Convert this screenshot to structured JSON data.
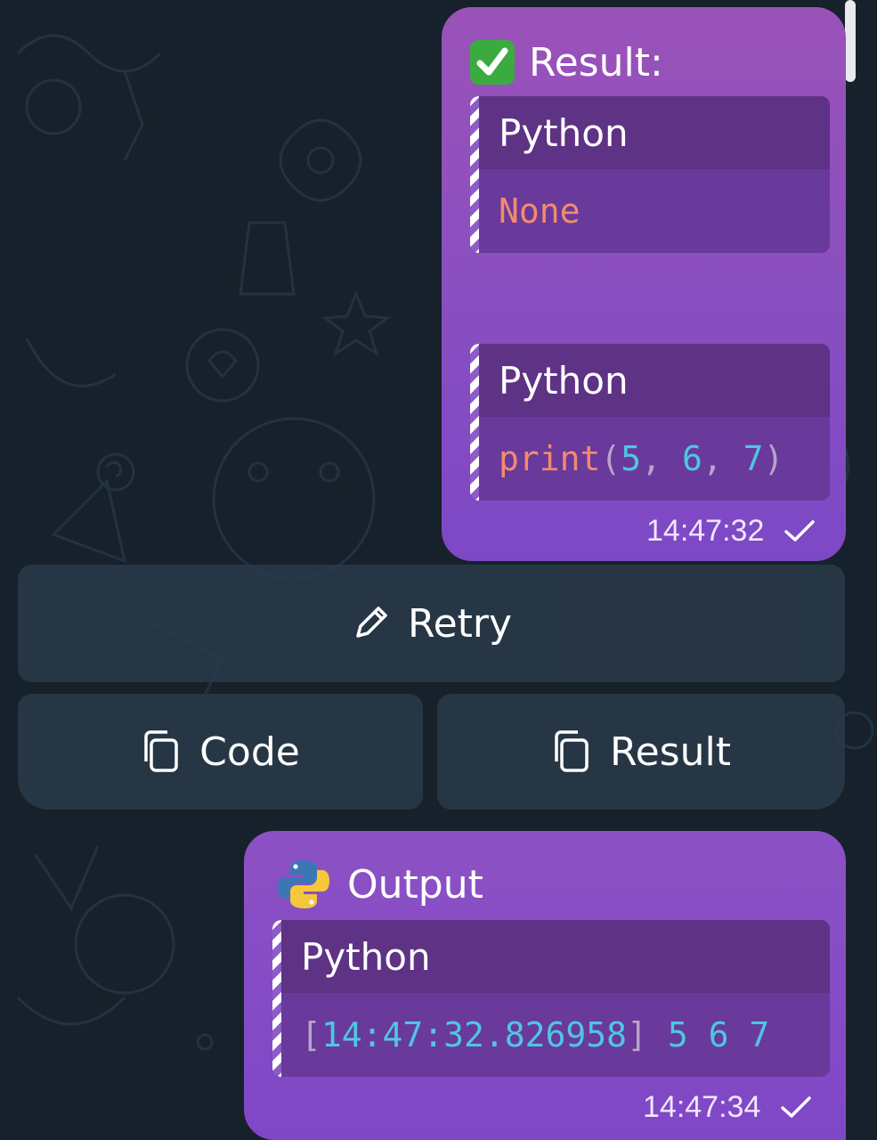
{
  "theme": {
    "background": "#17212b",
    "bubble_gradient_start": "#9a52b8",
    "bubble_gradient_end": "#7d48c6",
    "button_background": "#2a3a4a",
    "code_keyword_color": "#f28b6c",
    "code_number_color": "#4fc6e0"
  },
  "messages": [
    {
      "icon": "check-mark-emoji",
      "title": "Result:",
      "blocks": [
        {
          "language": "Python",
          "code": {
            "none": "None"
          }
        },
        {
          "language": "Python",
          "code": {
            "fn": "print",
            "open": "(",
            "a": "5",
            "sep1": ", ",
            "b": "6",
            "sep2": ", ",
            "c": "7",
            "close": ")"
          }
        }
      ],
      "time": "14:47:32",
      "status": "sent-check-icon"
    },
    {
      "icon": "python-logo-icon",
      "title": "Output",
      "blocks": [
        {
          "language": "Python",
          "code": {
            "lb": "[",
            "ts": "14:47:32.826958",
            "rb": "]",
            "vals": " 5 6 7"
          }
        }
      ],
      "time": "14:47:34",
      "status": "sent-check-icon"
    }
  ],
  "keyboard": {
    "retry": {
      "label": "Retry",
      "icon": "pencil-icon"
    },
    "copy_code": {
      "label": "Code",
      "icon": "copy-icon"
    },
    "copy_result": {
      "label": "Result",
      "icon": "copy-icon"
    }
  }
}
